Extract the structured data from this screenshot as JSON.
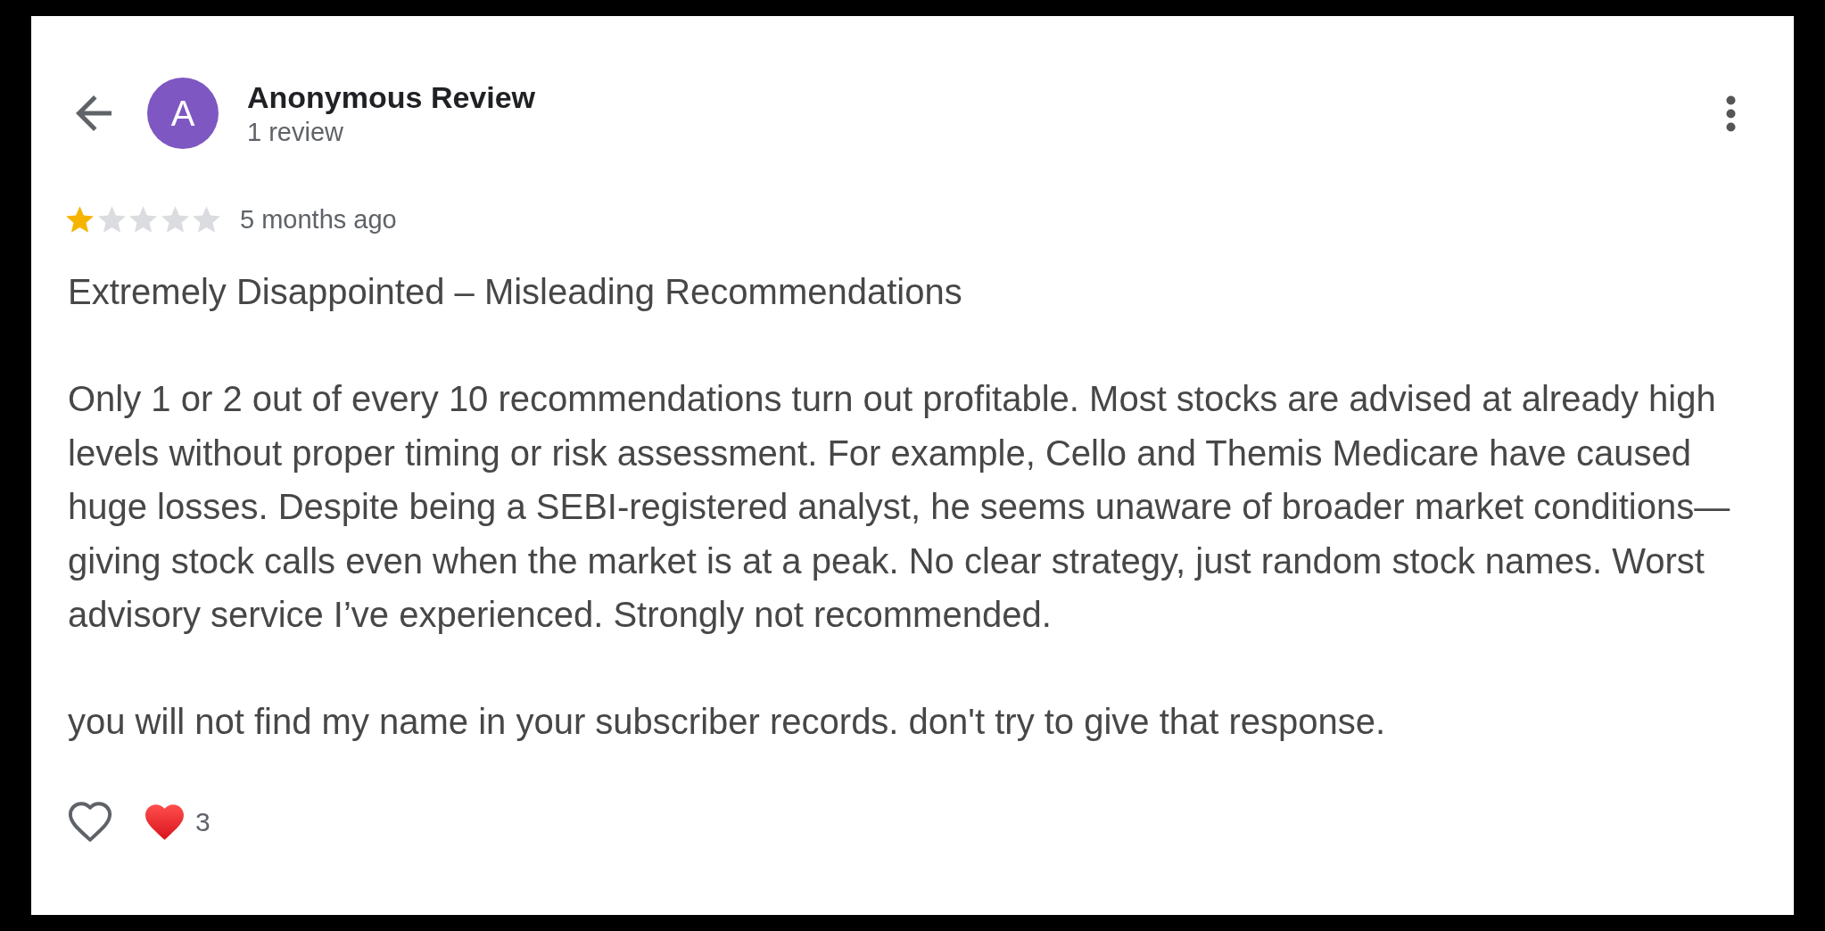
{
  "reviewer": {
    "initial": "A",
    "name": "Anonymous Review",
    "review_count": "1 review"
  },
  "review": {
    "stars": 1,
    "time": "5 months ago",
    "paragraphs": [
      "Extremely Disappointed – Misleading Recommendations",
      "Only 1 or 2 out of every 10 recommendations turn out profitable. Most stocks are advised at already high levels without proper timing or risk assessment. For example, Cello and Themis Medicare have caused huge losses. Despite being a SEBI-registered analyst, he seems unaware of broader market conditions—giving stock calls even when the market is at a peak. No clear strategy, just random stock names. Worst advisory service I’ve experienced. Strongly not recommended.",
      "you will not find my name in your subscriber records. don't try to give that response."
    ]
  },
  "reactions": {
    "liked": false,
    "count": "3"
  }
}
